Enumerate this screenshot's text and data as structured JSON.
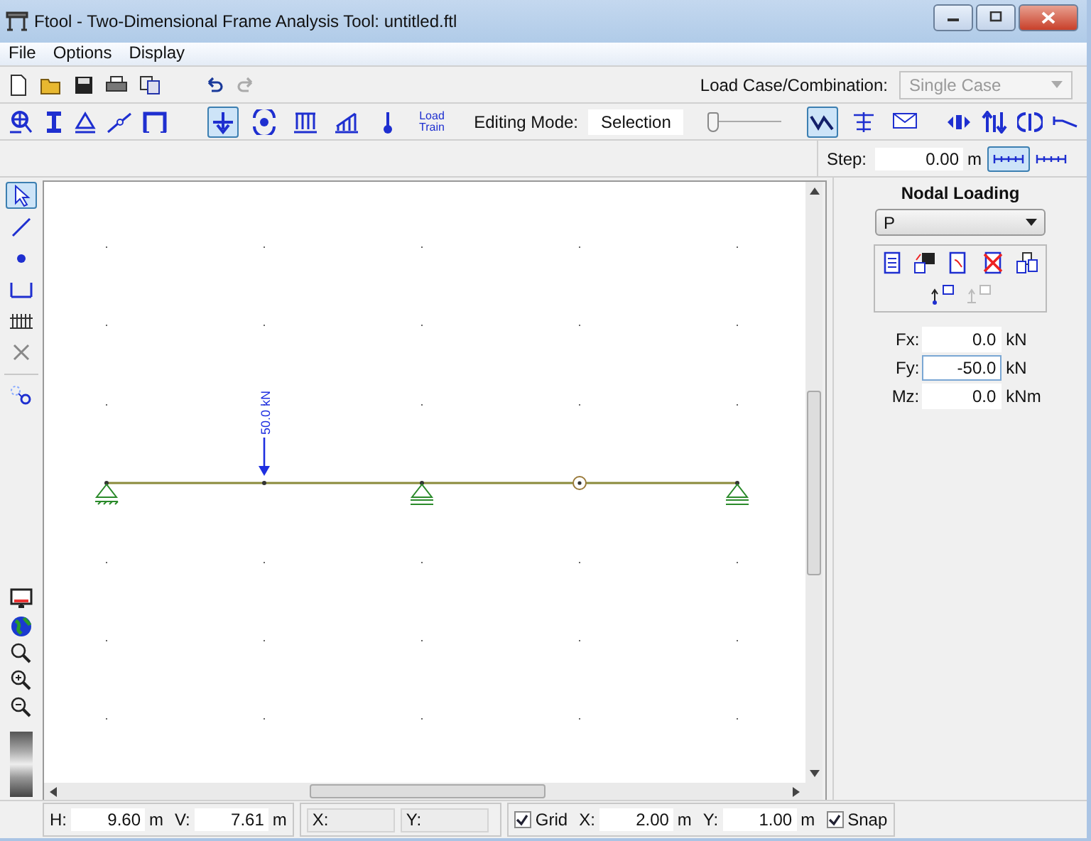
{
  "window": {
    "title": "Ftool - Two-Dimensional Frame Analysis Tool: untitled.ftl"
  },
  "menu": [
    "File",
    "Options",
    "Display"
  ],
  "load_case": {
    "label": "Load Case/Combination:",
    "value": "Single Case",
    "disabled": true
  },
  "load_tools": [
    {
      "kind": "nodal",
      "selected": true
    },
    {
      "kind": "displacement",
      "selected": false
    },
    {
      "kind": "uniform",
      "selected": false
    },
    {
      "kind": "linear",
      "selected": false
    },
    {
      "kind": "thermal",
      "selected": false
    },
    {
      "kind": "train",
      "label": "Load Train",
      "selected": false
    }
  ],
  "editing_mode": {
    "label": "Editing Mode:",
    "value": "Selection"
  },
  "zoom_slider": {
    "level": 0
  },
  "result_tools": [
    {
      "kind": "diagram",
      "selected": true
    },
    {
      "kind": "deformed",
      "selected": false
    },
    {
      "kind": "envelope",
      "selected": false
    }
  ],
  "step": {
    "label": "Step:",
    "value": "0.00",
    "unit": "m"
  },
  "step_modes": [
    {
      "selected": true
    },
    {
      "selected": false
    }
  ],
  "left_tools": [
    {
      "kind": "select",
      "selected": true
    },
    {
      "kind": "member",
      "selected": false
    },
    {
      "kind": "node",
      "selected": false
    },
    {
      "kind": "dimension",
      "selected": false
    },
    {
      "kind": "grid",
      "selected": false
    },
    {
      "kind": "delete",
      "selected": false
    }
  ],
  "panel": {
    "title": "Nodal Loading",
    "dropdown": "P",
    "fields": [
      {
        "label": "Fx:",
        "value": "0.0",
        "unit": "kN",
        "focused": false
      },
      {
        "label": "Fy:",
        "value": "-50.0",
        "unit": "kN",
        "focused": true
      },
      {
        "label": "Mz:",
        "value": "0.0",
        "unit": "kNm",
        "focused": false
      }
    ]
  },
  "canvas": {
    "load_label": "50.0 kN"
  },
  "status": {
    "h": {
      "label": "H:",
      "value": "9.60",
      "unit": "m"
    },
    "v": {
      "label": "V:",
      "value": "7.61",
      "unit": "m"
    },
    "x_label": "X:",
    "y_label": "Y:",
    "grid": {
      "label": "Grid",
      "checked": true
    },
    "grid_x": {
      "label": "X:",
      "value": "2.00",
      "unit": "m"
    },
    "grid_y": {
      "label": "Y:",
      "value": "1.00",
      "unit": "m"
    },
    "snap": {
      "label": "Snap",
      "checked": true
    }
  }
}
